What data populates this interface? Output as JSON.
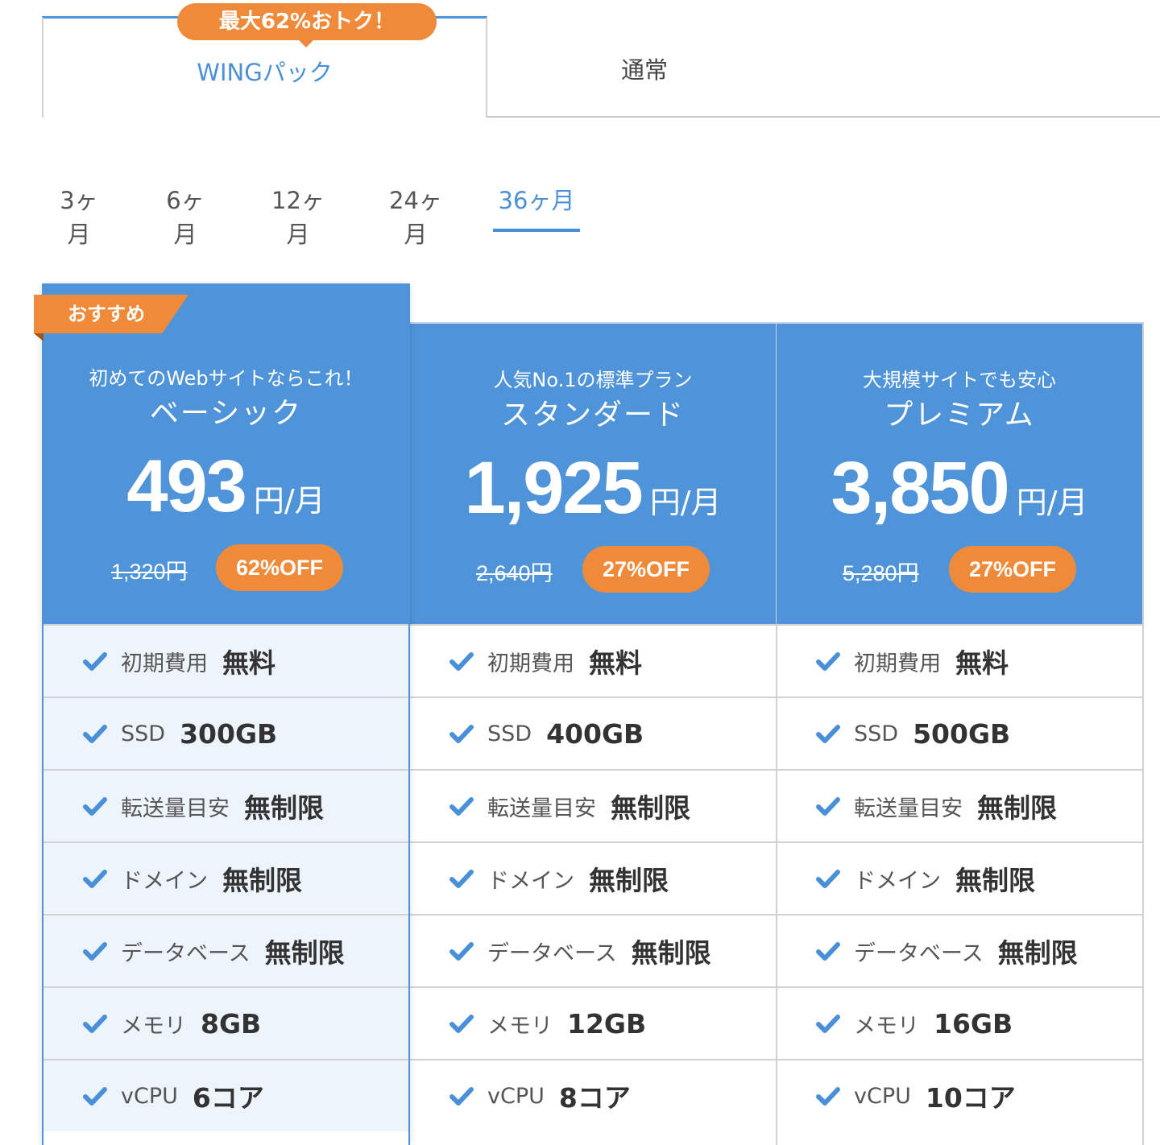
{
  "plan_type_tabs": {
    "deal_badge": "最大62%おトク！",
    "wing_label": "WINGパック",
    "normal_label": "通常"
  },
  "period_tabs": [
    {
      "label": "3ヶ月",
      "active": false
    },
    {
      "label": "6ヶ月",
      "active": false
    },
    {
      "label": "12ヶ月",
      "active": false
    },
    {
      "label": "24ヶ月",
      "active": false
    },
    {
      "label": "36ヶ月",
      "active": true
    }
  ],
  "recommend_label": "おすすめ",
  "plans": [
    {
      "tagline": "初めてのWebサイトならこれ！",
      "name": "ベーシック",
      "price": "493",
      "unit": "円/月",
      "old_price": "1,320円",
      "discount": "62%OFF",
      "features": [
        {
          "label": "初期費用",
          "value": "無料"
        },
        {
          "label": "SSD",
          "value": "300GB"
        },
        {
          "label": "転送量目安",
          "value": "無制限"
        },
        {
          "label": "ドメイン",
          "value": "無制限"
        },
        {
          "label": "データベース",
          "value": "無制限"
        },
        {
          "label": "メモリ",
          "value": "8GB"
        },
        {
          "label": "vCPU",
          "value": "6コア"
        }
      ]
    },
    {
      "tagline": "人気No.1の標準プラン",
      "name": "スタンダード",
      "price": "1,925",
      "unit": "円/月",
      "old_price": "2,640円",
      "discount": "27%OFF",
      "features": [
        {
          "label": "初期費用",
          "value": "無料"
        },
        {
          "label": "SSD",
          "value": "400GB"
        },
        {
          "label": "転送量目安",
          "value": "無制限"
        },
        {
          "label": "ドメイン",
          "value": "無制限"
        },
        {
          "label": "データベース",
          "value": "無制限"
        },
        {
          "label": "メモリ",
          "value": "12GB"
        },
        {
          "label": "vCPU",
          "value": "8コア"
        }
      ]
    },
    {
      "tagline": "大規模サイトでも安心",
      "name": "プレミアム",
      "price": "3,850",
      "unit": "円/月",
      "old_price": "5,280円",
      "discount": "27%OFF",
      "features": [
        {
          "label": "初期費用",
          "value": "無料"
        },
        {
          "label": "SSD",
          "value": "500GB"
        },
        {
          "label": "転送量目安",
          "value": "無制限"
        },
        {
          "label": "ドメイン",
          "value": "無制限"
        },
        {
          "label": "データベース",
          "value": "無制限"
        },
        {
          "label": "メモリ",
          "value": "16GB"
        },
        {
          "label": "vCPU",
          "value": "10コア"
        }
      ]
    }
  ],
  "colors": {
    "accent": "#4f94d9",
    "orange": "#ef8a3b",
    "highlight_bg": "#edf4fc"
  },
  "icons": {
    "feature": "check-icon"
  }
}
